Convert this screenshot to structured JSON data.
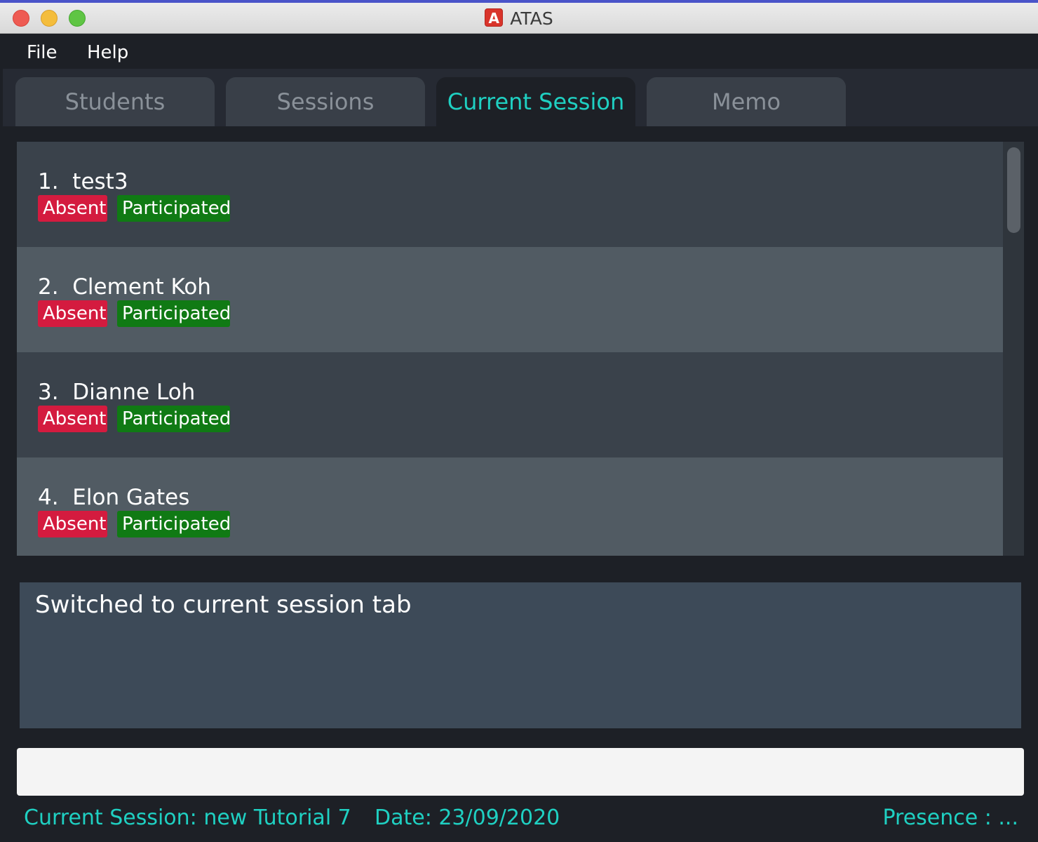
{
  "window": {
    "title": "ATAS",
    "app_icon_letter": "A"
  },
  "menu": {
    "file": "File",
    "help": "Help"
  },
  "tabs": [
    {
      "label": "Students",
      "active": false
    },
    {
      "label": "Sessions",
      "active": false
    },
    {
      "label": "Current Session",
      "active": true
    },
    {
      "label": "Memo",
      "active": false
    }
  ],
  "students": [
    {
      "name": "1.  test3",
      "absent_label": "Absent",
      "participated_label": "Participated"
    },
    {
      "name": "2.  Clement Koh",
      "absent_label": "Absent",
      "participated_label": "Participated"
    },
    {
      "name": "3.  Dianne Loh",
      "absent_label": "Absent",
      "participated_label": "Participated"
    },
    {
      "name": "4.  Elon Gates",
      "absent_label": "Absent",
      "participated_label": "Participated"
    }
  ],
  "result_display": {
    "text": "Switched to current session tab"
  },
  "command_box": {
    "value": ""
  },
  "status_bar": {
    "session": "Current Session: new Tutorial 7",
    "date": "Date: 23/09/2020",
    "presence": "Presence : ..."
  },
  "colors": {
    "accent": "#1fd0c2",
    "absent_tag": "#d41b3f",
    "participated_tag": "#107a14"
  }
}
